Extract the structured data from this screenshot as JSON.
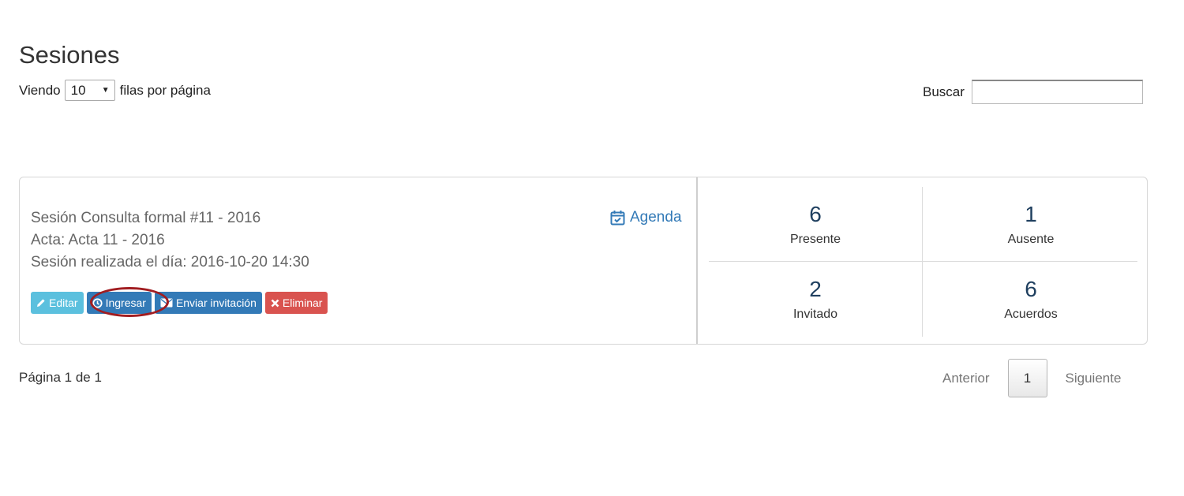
{
  "header": {
    "title": "Sesiones"
  },
  "length": {
    "prefix": "Viendo",
    "value": "10",
    "suffix": "filas por página"
  },
  "search": {
    "label": "Buscar",
    "value": ""
  },
  "session": {
    "title": "Sesión Consulta formal #11 - 2016",
    "acta": "Acta: Acta 11 - 2016",
    "date": "Sesión realizada el día: 2016-10-20 14:30",
    "agenda_label": "Agenda",
    "buttons": {
      "edit": "Editar",
      "enter": "Ingresar",
      "invite": "Enviar invitación",
      "delete": "Eliminar"
    },
    "stats": {
      "present": {
        "value": "6",
        "label": "Presente"
      },
      "absent": {
        "value": "1",
        "label": "Ausente"
      },
      "invited": {
        "value": "2",
        "label": "Invitado"
      },
      "agreements": {
        "value": "6",
        "label": "Acuerdos"
      }
    }
  },
  "pagination": {
    "info": "Página 1 de 1",
    "previous": "Anterior",
    "current": "1",
    "next": "Siguiente"
  },
  "colors": {
    "info": "#5bc0de",
    "primary": "#337ab7",
    "danger": "#d9534f",
    "highlight": "#a11d21"
  },
  "icons": [
    "calendar-check-icon",
    "pencil-icon",
    "clock-icon",
    "envelope-icon",
    "times-icon",
    "caret-down-icon"
  ]
}
